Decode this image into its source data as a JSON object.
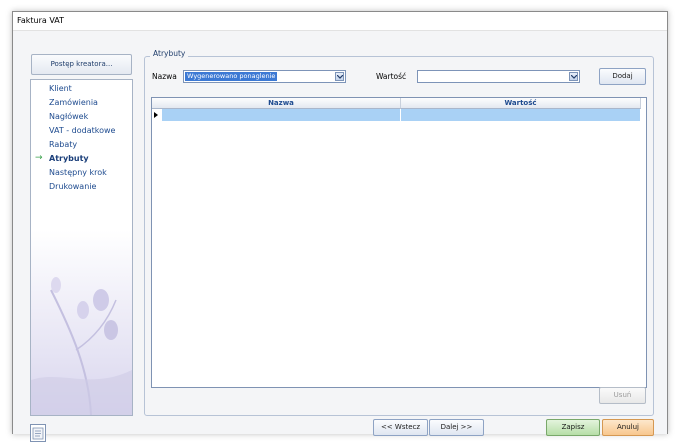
{
  "window": {
    "title": "Faktura VAT"
  },
  "sidebar": {
    "header": "Postęp kreatora...",
    "items": [
      {
        "label": "Klient",
        "active": false
      },
      {
        "label": "Zamówienia",
        "active": false
      },
      {
        "label": "Nagłówek",
        "active": false
      },
      {
        "label": "VAT - dodatkowe",
        "active": false
      },
      {
        "label": "Rabaty",
        "active": false
      },
      {
        "label": "Atrybuty",
        "active": true
      },
      {
        "label": "Następny krok",
        "active": false
      },
      {
        "label": "Drukowanie",
        "active": false
      }
    ],
    "active_marker": "→"
  },
  "group": {
    "title": "Atrybuty"
  },
  "form": {
    "name_label": "Nazwa",
    "name_value": "Wygenerowano ponaglenie",
    "value_label": "Wartość",
    "value_value": "",
    "add_button": "Dodaj"
  },
  "grid": {
    "columns": [
      "Nazwa",
      "Wartość"
    ],
    "rows": [
      {
        "Nazwa": "",
        "Wartość": "",
        "selected": true
      }
    ]
  },
  "buttons": {
    "remove": "Usuń",
    "back": "<< Wstecz",
    "next": "Dalej >>",
    "save": "Zapisz",
    "cancel": "Anuluj"
  },
  "colors": {
    "accent": "#3c79d4",
    "selected_row": "#a9d1f5",
    "active_arrow": "#3aa14b"
  }
}
